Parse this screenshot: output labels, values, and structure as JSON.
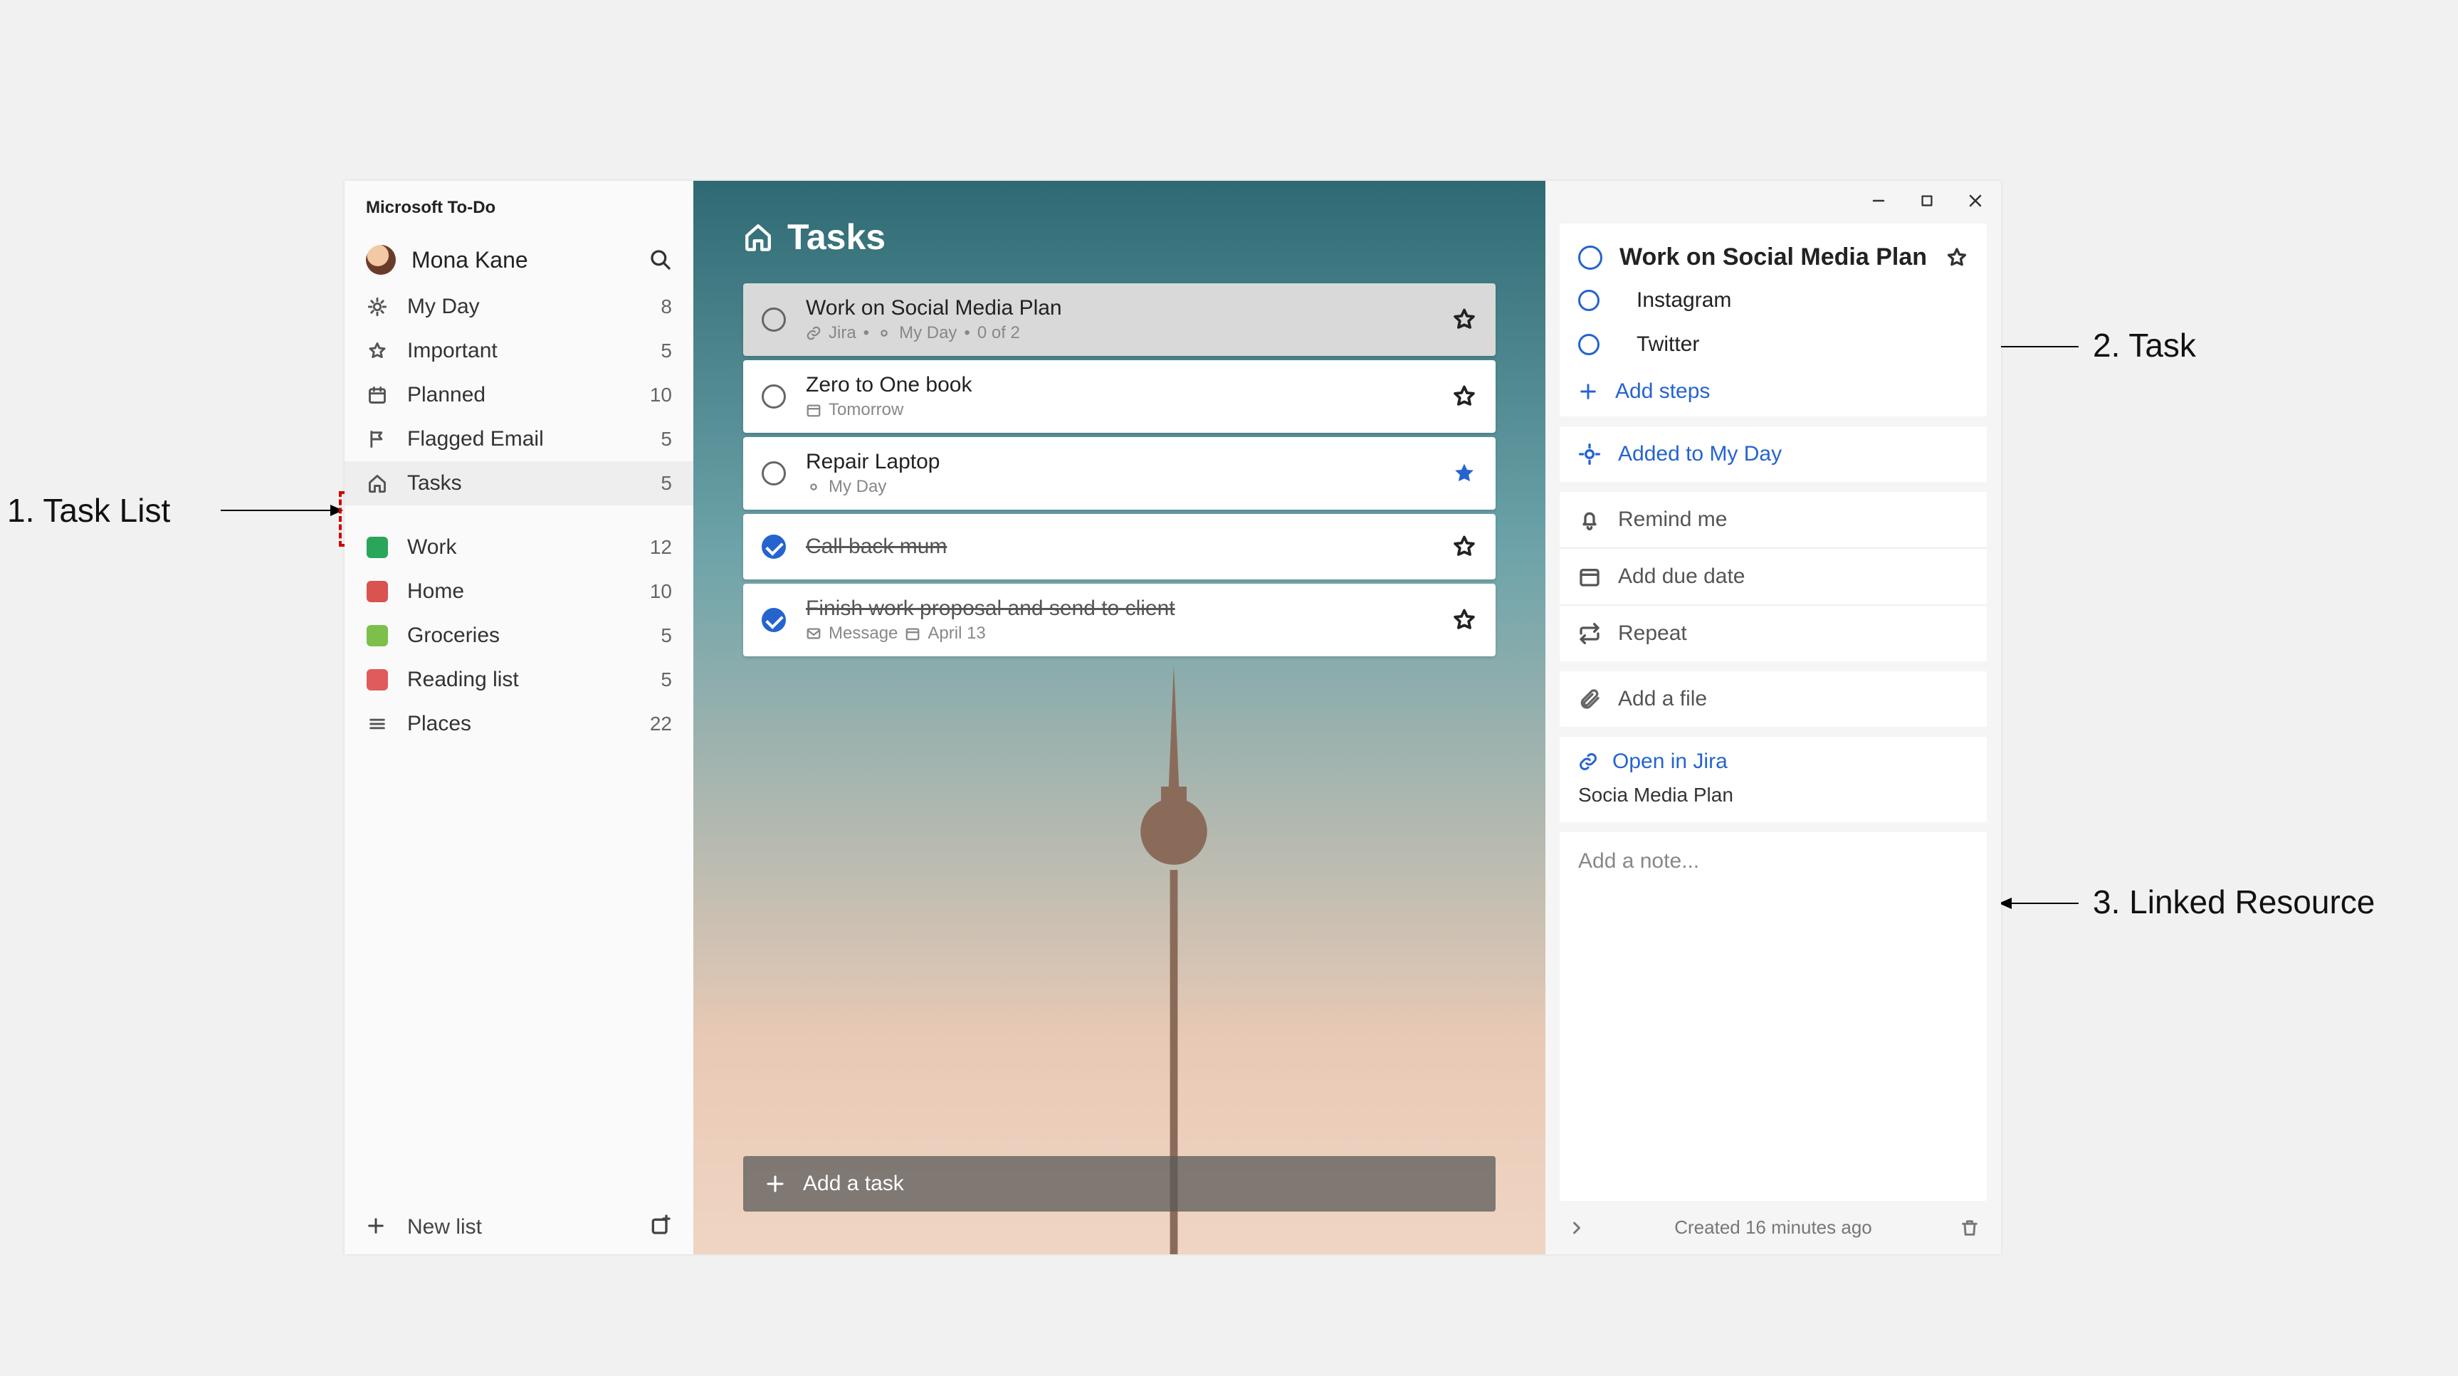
{
  "annotations": {
    "task_list": "1. Task List",
    "task": "2. Task",
    "linked_resource": "3. Linked Resource"
  },
  "app_title": "Microsoft To-Do",
  "user": {
    "name": "Mona Kane"
  },
  "sidebar": {
    "smart_lists": [
      {
        "icon": "sun",
        "label": "My Day",
        "count": "8"
      },
      {
        "icon": "star",
        "label": "Important",
        "count": "5"
      },
      {
        "icon": "calendar",
        "label": "Planned",
        "count": "10"
      },
      {
        "icon": "flag",
        "label": "Flagged Email",
        "count": "5"
      },
      {
        "icon": "home",
        "label": "Tasks",
        "count": "5",
        "selected": true
      }
    ],
    "user_lists": [
      {
        "color": "#2aa65a",
        "label": "Work",
        "count": "12"
      },
      {
        "color": "#d9534f",
        "label": "Home",
        "count": "10"
      },
      {
        "color": "#7cc04b",
        "label": "Groceries",
        "count": "5"
      },
      {
        "color": "#e05b5b",
        "label": "Reading list",
        "count": "5"
      },
      {
        "icon": "lines",
        "label": "Places",
        "count": "22"
      }
    ],
    "new_list": "New list"
  },
  "main": {
    "title": "Tasks",
    "add_task": "Add a task",
    "tasks": [
      {
        "title": "Work on Social Media Plan",
        "done": false,
        "selected": true,
        "starred": false,
        "meta_parts": [
          "Jira",
          "My Day",
          "0 of 2"
        ],
        "meta_prefix_icon": "link",
        "meta_mid_icon": "sun"
      },
      {
        "title": "Zero to One book",
        "done": false,
        "selected": false,
        "starred": false,
        "meta_parts": [
          "Tomorrow"
        ],
        "meta_prefix_icon": "calendar"
      },
      {
        "title": "Repair Laptop",
        "done": false,
        "selected": false,
        "starred": true,
        "star_fill": true,
        "meta_parts": [
          "My Day"
        ],
        "meta_prefix_icon": "sun"
      },
      {
        "title": "Call back mum",
        "done": true,
        "selected": false,
        "starred": false,
        "meta_parts": []
      },
      {
        "title": "Finish work proposal and send to client",
        "done": true,
        "selected": false,
        "starred": false,
        "meta_parts": [
          "Message",
          "April 13"
        ],
        "meta_prefix_icon": "mail",
        "meta_mid_icon": "calendar"
      }
    ]
  },
  "details": {
    "title": "Work on Social Media Plan",
    "steps": [
      {
        "label": "Instagram"
      },
      {
        "label": "Twitter"
      }
    ],
    "add_steps": "Add steps",
    "my_day": "Added to My Day",
    "remind": "Remind me",
    "due": "Add due date",
    "repeat": "Repeat",
    "file": "Add a file",
    "linked": {
      "open": "Open in Jira",
      "sub": "Socia Media Plan"
    },
    "note_placeholder": "Add a note...",
    "created": "Created 16 minutes ago"
  }
}
